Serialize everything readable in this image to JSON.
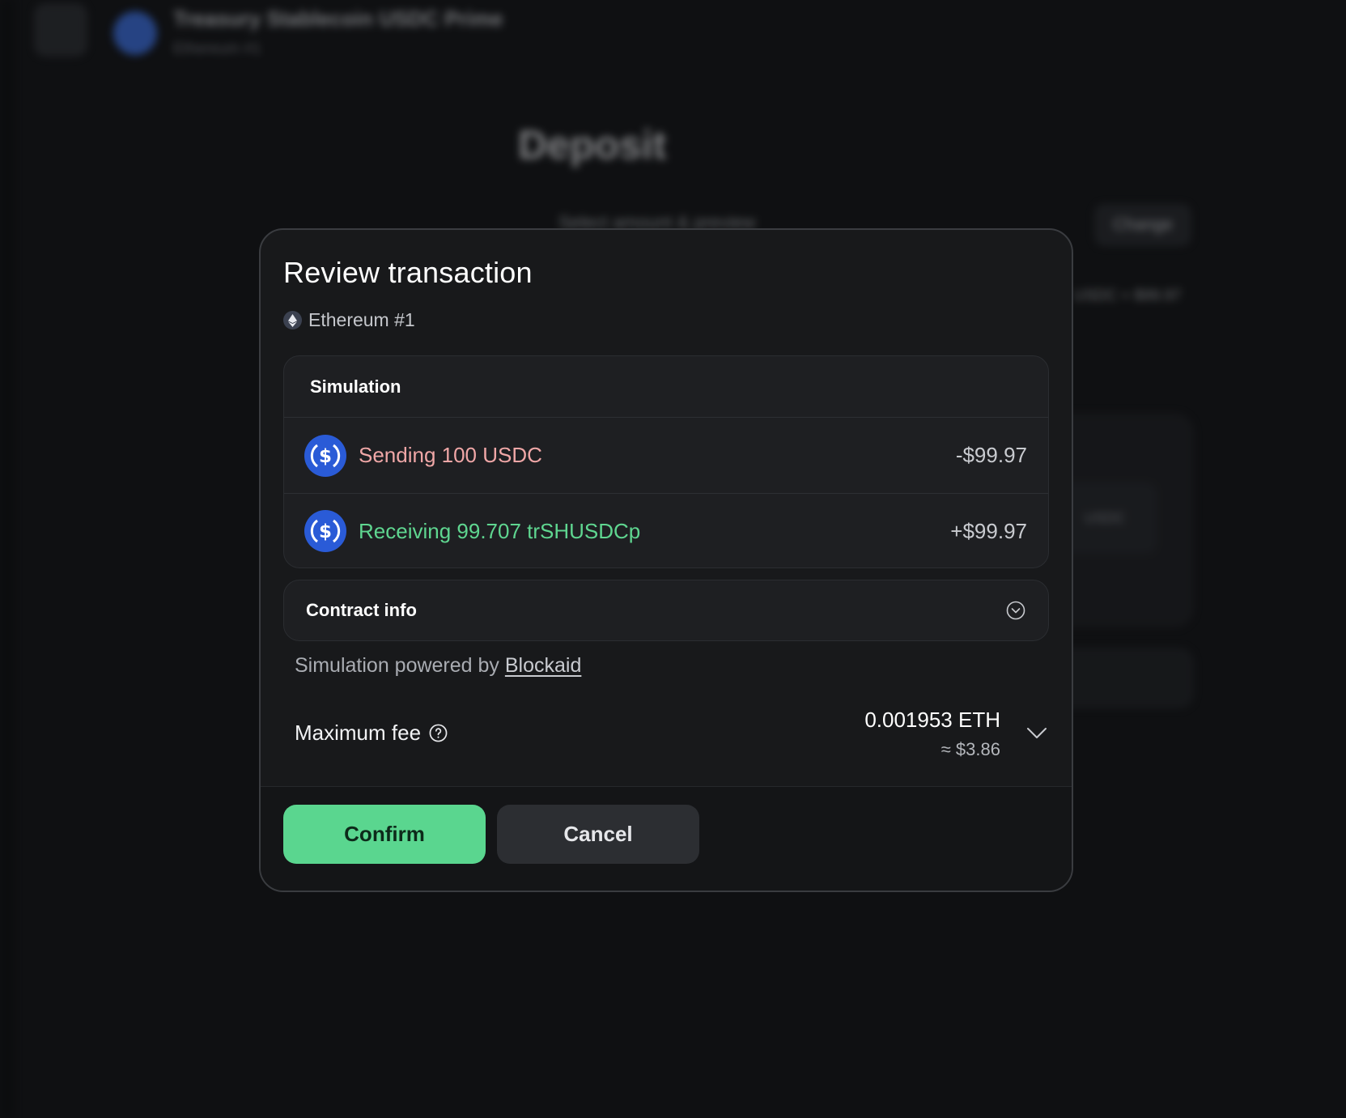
{
  "background": {
    "page_title": "Treasury Stablecoin USDC Prime",
    "page_subtitle": "Ethereum #1",
    "heading": "Deposit",
    "row_text": "Select amount & preview",
    "change_label": "Change",
    "chip_label": "USDC ≈ $99.97",
    "panel_label": "USDC"
  },
  "modal": {
    "title": "Review transaction",
    "account": "Ethereum #1",
    "simulation": {
      "header": "Simulation",
      "rows": [
        {
          "label": "Sending 100 USDC",
          "amount": "-$99.97",
          "kind": "send",
          "icon": "usdc-coin-icon"
        },
        {
          "label": "Receiving 99.707 trSHUSDCp",
          "amount": "+$99.97",
          "kind": "receive",
          "icon": "usdc-coin-icon"
        }
      ]
    },
    "contract_info": {
      "label": "Contract info"
    },
    "powered_by": {
      "prefix": "Simulation powered by ",
      "link": "Blockaid"
    },
    "fee": {
      "label": "Maximum fee",
      "eth": "0.001953 ETH",
      "usd": "≈ $3.86"
    },
    "buttons": {
      "confirm": "Confirm",
      "cancel": "Cancel"
    }
  },
  "colors": {
    "accent_green": "#5ad68f",
    "send_red": "#f0a7a7",
    "receive_green": "#5fd690",
    "usdc_blue": "#2a5bd7"
  }
}
